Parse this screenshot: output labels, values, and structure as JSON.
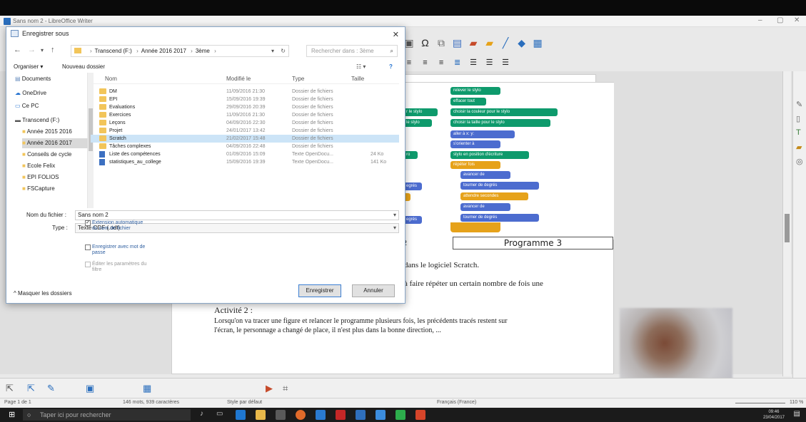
{
  "window": {
    "title": "Sans nom 2 - LibreOffice Writer"
  },
  "dialog": {
    "title": "Enregistrer sous",
    "breadcrumb": [
      "Transcend (F:)",
      "Année 2016 2017",
      "3ème"
    ],
    "search_placeholder": "Rechercher dans : 3ème",
    "toolbar": {
      "organize": "Organiser ▾",
      "new_folder": "Nouveau dossier"
    },
    "nav_items": [
      "Documents",
      "OneDrive",
      "Ce PC",
      "Transcend (F:)",
      "Année 2015 2016",
      "Année 2016 2017",
      "Conseils de cycle",
      "Ecole Felix",
      "EPI FOLIOS",
      "FSCapture"
    ],
    "columns": {
      "name": "Nom",
      "modified": "Modifié le",
      "type": "Type",
      "size": "Taille"
    },
    "files": [
      {
        "name": "DM",
        "modified": "11/09/2016 21:30",
        "type": "Dossier de fichiers",
        "size": "",
        "kind": "folder"
      },
      {
        "name": "EPI",
        "modified": "15/09/2016 19:39",
        "type": "Dossier de fichiers",
        "size": "",
        "kind": "folder"
      },
      {
        "name": "Evaluations",
        "modified": "29/09/2016 20:39",
        "type": "Dossier de fichiers",
        "size": "",
        "kind": "folder"
      },
      {
        "name": "Exercices",
        "modified": "11/09/2016 21:30",
        "type": "Dossier de fichiers",
        "size": "",
        "kind": "folder"
      },
      {
        "name": "Leçons",
        "modified": "04/09/2016 22:30",
        "type": "Dossier de fichiers",
        "size": "",
        "kind": "folder"
      },
      {
        "name": "Projet",
        "modified": "24/01/2017 13:42",
        "type": "Dossier de fichiers",
        "size": "",
        "kind": "folder"
      },
      {
        "name": "Scratch",
        "modified": "21/02/2017 15:48",
        "type": "Dossier de fichiers",
        "size": "",
        "kind": "folder"
      },
      {
        "name": "Tâches complexes",
        "modified": "04/09/2016 22:48",
        "type": "Dossier de fichiers",
        "size": "",
        "kind": "folder"
      },
      {
        "name": "Liste des compétences",
        "modified": "01/09/2016 15:09",
        "type": "Texte OpenDocu...",
        "size": "24 Ko",
        "kind": "doc"
      },
      {
        "name": "statistiques_au_college",
        "modified": "15/09/2016 19:39",
        "type": "Texte OpenDocu...",
        "size": "141 Ko",
        "kind": "doc"
      }
    ],
    "filename_label": "Nom du fichier :",
    "filename_value": "Sans nom 2",
    "type_label": "Type :",
    "type_value": "Texte ODF (.odt)",
    "options": {
      "auto_ext": "Extension automatique du nom de fichier",
      "password": "Enregistrer avec mot de passe",
      "filter": "Éditer les paramètres du filtre"
    },
    "save_button": "Enregistrer",
    "cancel_button": "Annuler",
    "hide_folders": "Masquer les dossiers"
  },
  "document": {
    "program_label": "Programme 3",
    "digit_fragment": "2",
    "line1": "dans le logiciel Scratch.",
    "line2": "à faire répéter un certain nombre de fois une",
    "activity_title": "Activité 2 :",
    "para_line1": "Lorsqu'on va tracer une figure et relancer le programme plusieurs fois, les précédents tracés restent sur",
    "para_line2": "l'écran, le personnage a changé de place, il n'est plus dans la bonne direction, ...",
    "scratch_blocks": [
      "relever le stylo",
      "effacer tout",
      "choisir la couleur pour le stylo",
      "choisir la taille pour le stylo",
      "aller à x: y:",
      "s'orienter à",
      "stylo en position d'écriture",
      "répéter fois",
      "avancer de",
      "tourner de degrés",
      "attendre secondes",
      "avancer de",
      "tourner de degrés"
    ],
    "left_blocks": [
      "r le stylo",
      "le stylo",
      "ro",
      "egrés",
      "egrés"
    ]
  },
  "statusbar": {
    "page": "Page 1 de 1",
    "words": "146 mots, 939 caractères",
    "style": "Style par défaut",
    "language": "Français (France)",
    "zoom": "110 %"
  },
  "taskbar": {
    "search": "Taper ici pour rechercher",
    "time": "09:46",
    "date": "23/04/2017"
  }
}
